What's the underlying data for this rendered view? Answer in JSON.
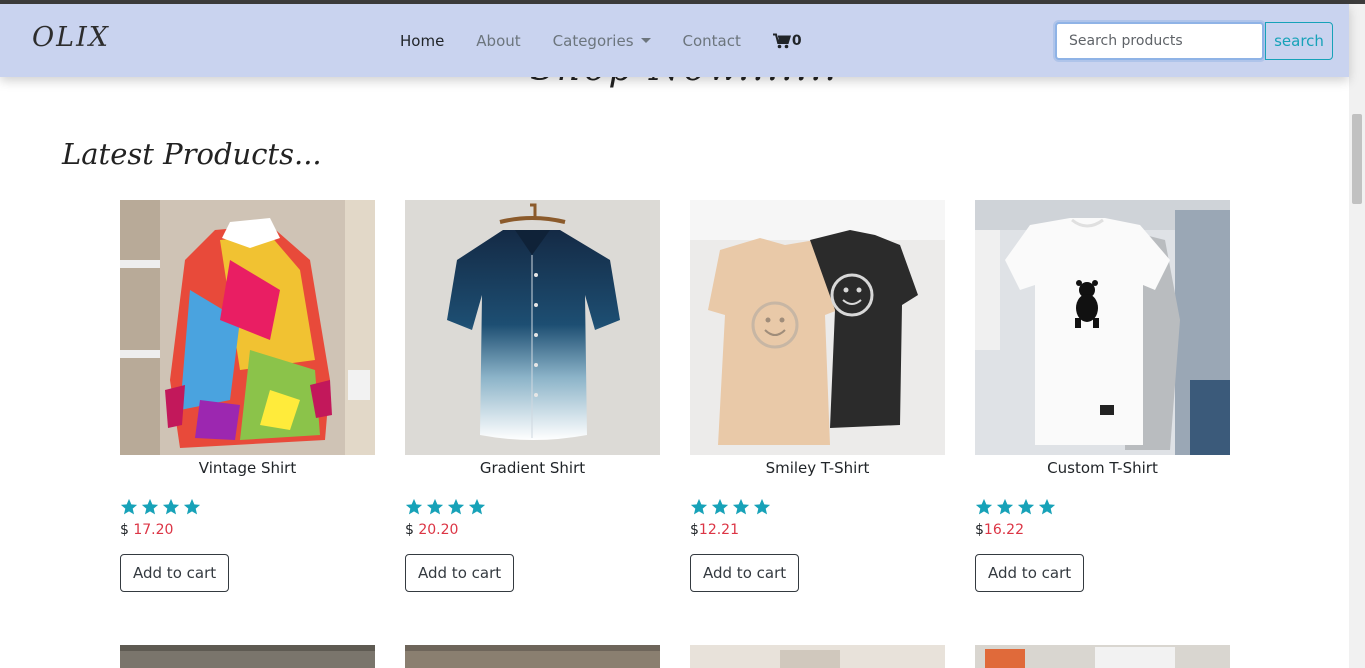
{
  "navbar": {
    "brand": "OLIX",
    "links": [
      {
        "label": "Home",
        "active": true
      },
      {
        "label": "About"
      },
      {
        "label": "Categories",
        "dropdown": true
      },
      {
        "label": "Contact"
      }
    ],
    "cart_count": "0",
    "search_placeholder": "Search products",
    "search_label": "search"
  },
  "hero_partial_text": "Shop Now.......",
  "section_title": "Latest Products...",
  "products": [
    {
      "name": "Vintage Shirt",
      "currency": "$ ",
      "price": "17.20",
      "rating": 4,
      "button": "Add to cart"
    },
    {
      "name": "Gradient Shirt",
      "currency": "$ ",
      "price": "20.20",
      "rating": 4,
      "button": "Add to cart"
    },
    {
      "name": "Smiley T-Shirt",
      "currency": "$",
      "price": "12.21",
      "rating": 4,
      "button": "Add to cart"
    },
    {
      "name": "Custom T-Shirt",
      "currency": "$",
      "price": "16.22",
      "rating": 4,
      "button": "Add to cart"
    }
  ],
  "colors": {
    "navbar": "#c9d3ef",
    "accent": "#17a2b8",
    "price": "#dc3545",
    "star": "#17a2b8"
  }
}
